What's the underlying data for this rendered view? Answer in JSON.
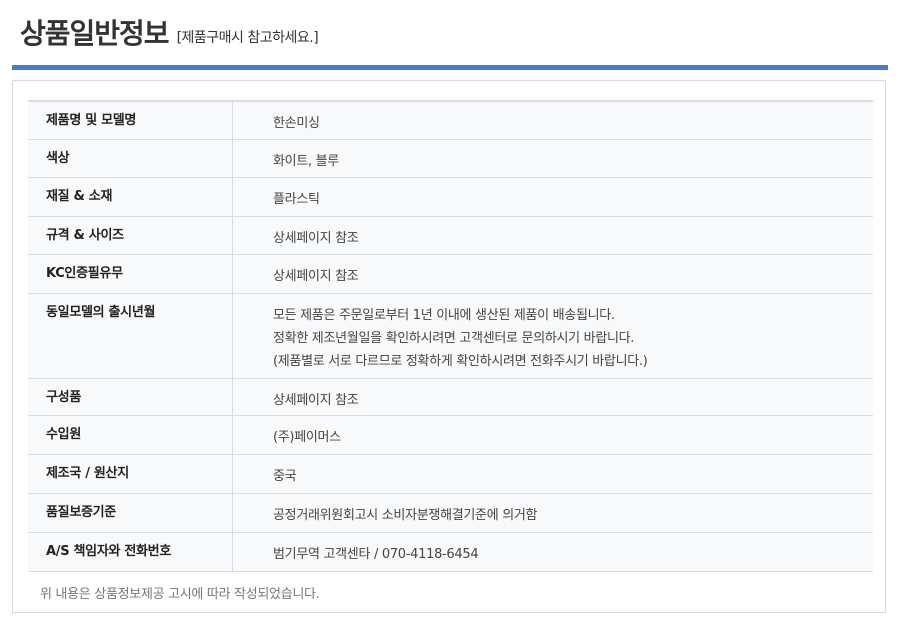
{
  "header": {
    "title": "상품일반정보",
    "subtitle": "[제품구매시 참고하세요.]"
  },
  "rows": [
    {
      "label": "제품명 및 모델명",
      "value": [
        "한손미싱"
      ]
    },
    {
      "label": "색상",
      "value": [
        "화이트, 블루"
      ]
    },
    {
      "label": "재질 & 소재",
      "value": [
        "플라스틱"
      ]
    },
    {
      "label": "규격 & 사이즈",
      "value": [
        "상세페이지 참조"
      ]
    },
    {
      "label": "KC인증필유무",
      "value": [
        "상세페이지 참조"
      ]
    },
    {
      "label": "동일모델의 출시년월",
      "value": [
        "모든 제품은 주문일로부터 1년 이내에 생산된 제품이 배송됩니다.",
        "정확한 제조년월일을 확인하시려면 고객센터로 문의하시기 바랍니다.",
        "(제품별로 서로 다르므로 정확하게 확인하시려면 전화주시기 바랍니다.)"
      ]
    },
    {
      "label": "구성품",
      "value": [
        "상세페이지 참조"
      ]
    },
    {
      "label": "수입원",
      "value": [
        "(주)페이머스"
      ]
    },
    {
      "label": "제조국 / 원산지",
      "value": [
        "중국"
      ]
    },
    {
      "label": "품질보증기준",
      "value": [
        "공정거래위원회고시 소비자분쟁해결기준에 의거함"
      ]
    },
    {
      "label": "A/S 책임자와 전화번호",
      "value": [
        "범기무역 고객센타 / 070-4118-6454"
      ]
    }
  ],
  "footnote": "위 내용은 상품정보제공 고시에 따라 작성되었습니다.",
  "colors": {
    "accent_bar": "#4a7ec7",
    "row_background": "#f8f9fb",
    "border": "#d9dde3"
  }
}
